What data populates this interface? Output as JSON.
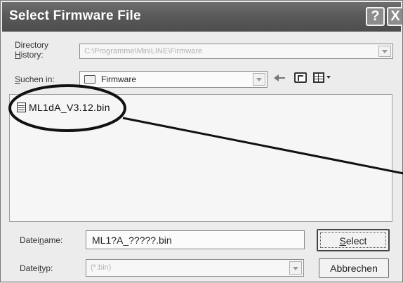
{
  "dialog": {
    "title": "Select Firmware File",
    "help_glyph": "?",
    "close_glyph": "X"
  },
  "directory_history": {
    "label_line1": "Directory",
    "label_line2_prefix": "",
    "label_line2_underlined": "H",
    "label_line2_rest": "istory:",
    "value": "C:\\Programme\\MiniLINE\\Firmware"
  },
  "look_in": {
    "label_prefix": "",
    "label_underlined": "S",
    "label_rest": "uchen in:",
    "value": "Firmware"
  },
  "toolbar": {
    "icons": [
      "back-arrow-icon",
      "up-folder-icon",
      "view-menu-icon"
    ]
  },
  "file_list": {
    "items": [
      {
        "name": "ML1dA_V3.12.bin",
        "icon": "bin-file-icon"
      }
    ]
  },
  "filename": {
    "label_prefix": "Datei",
    "label_underlined": "n",
    "label_rest": "ame:",
    "value": "ML1?A_?????.bin"
  },
  "filetype": {
    "label_prefix": "Datei",
    "label_underlined": "t",
    "label_rest": "yp:",
    "value": "(*.bin)"
  },
  "buttons": {
    "select_underlined": "S",
    "select_rest": "elect",
    "cancel": "Abbrechen"
  },
  "colors": {
    "titlebar": "#5a5a5a",
    "dialog_bg": "#ececec",
    "annotation": "#111111"
  }
}
